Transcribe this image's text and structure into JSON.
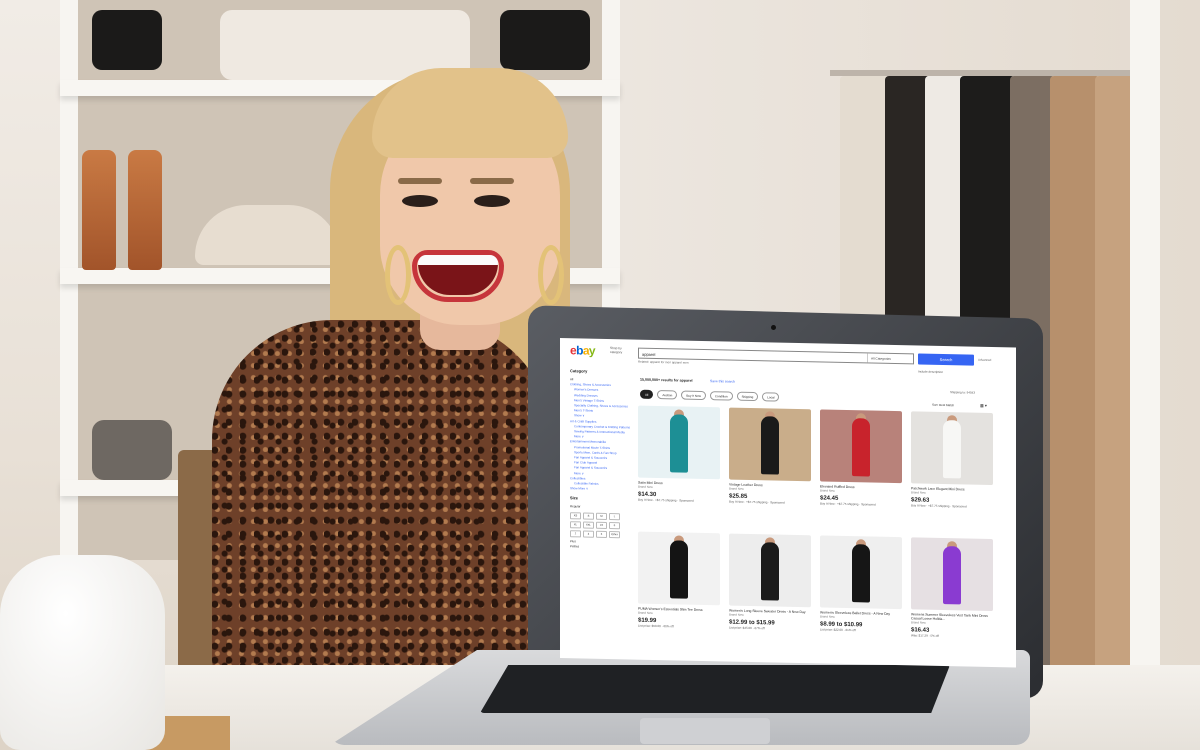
{
  "ebay": {
    "logo": {
      "e": "e",
      "b": "b",
      "a": "a",
      "y": "y"
    },
    "shop_by_category": "Shop by category",
    "search": {
      "value": "apparel",
      "category": "All Categories",
      "button": "Search",
      "advanced": "Advanced"
    },
    "related": "Related:  apparel for men   apparel men",
    "include_description": "Include description",
    "results_count": "15,000,000+ results for apparel",
    "save_search": "Save this search",
    "shipping_to": "Shipping to: 94043",
    "filters": [
      "All",
      "Auction",
      "Buy It Now",
      "Condition",
      "Shipping",
      "Local"
    ],
    "sort": "Sort: Best Match",
    "view_toggle": "▦ ▾",
    "sidebar": {
      "category_title": "Category",
      "items": [
        {
          "label": "All",
          "style": "plain"
        },
        {
          "label": "Clothing, Shoes & Accessories",
          "style": "link"
        },
        {
          "label": "Women's Dresses",
          "style": "indent"
        },
        {
          "label": "Wedding Dresses",
          "style": "indent"
        },
        {
          "label": "Men's Vintage T-Shirts",
          "style": "indent"
        },
        {
          "label": "Specialty Clothing, Shoes & Accessories",
          "style": "indent"
        },
        {
          "label": "Men's T-Shirts",
          "style": "indent"
        },
        {
          "label": "Show ∨",
          "style": "indent"
        },
        {
          "label": "Art & Craft Supplies",
          "style": "link"
        },
        {
          "label": "Contemporary Crochet & Knitting Patterns",
          "style": "indent"
        },
        {
          "label": "Sewing Patterns & Instructional Media",
          "style": "indent"
        },
        {
          "label": "More ∨",
          "style": "indent"
        },
        {
          "label": "Entertainment Memorabilia",
          "style": "link"
        },
        {
          "label": "Promotional Movie T-Shirts",
          "style": "indent"
        },
        {
          "label": "Sports Mem, Cards & Fan Shop",
          "style": "indent"
        },
        {
          "label": "Fan Apparel & Souvenirs",
          "style": "indent"
        },
        {
          "label": "Fan Club Apparel",
          "style": "indent"
        },
        {
          "label": "Fan Apparel & Souvenirs",
          "style": "indent"
        },
        {
          "label": "More ∨",
          "style": "indent"
        },
        {
          "label": "Collectibles",
          "style": "link"
        },
        {
          "label": "Collectible Fabrics",
          "style": "indent"
        },
        {
          "label": "Show More ∨",
          "style": "link"
        }
      ],
      "size_title": "Size",
      "size_type": "Regular",
      "sizes": [
        "XS",
        "S",
        "M",
        "L",
        "XL",
        "XXL",
        "2X",
        "0",
        "2",
        "4",
        "6",
        "Other"
      ],
      "plus": "Plus",
      "petites": "Petites"
    },
    "products": [
      {
        "title": "Satin Mini Dress",
        "cond": "Brand New",
        "price": "$14.30",
        "meta": "Buy It Now · +$7.75 shipping · Sponsored",
        "bg": "#e8f2f4",
        "fig": "#1d8f95"
      },
      {
        "title": "Vintage Leather Dress",
        "cond": "Brand New",
        "price": "$25.85",
        "meta": "Buy It Now · +$7.75 shipping · Sponsored",
        "bg": "#c9ad8a",
        "fig": "#1a1a1a"
      },
      {
        "title": "Elevated Ruffled Dress",
        "cond": "Brand New",
        "price": "$24.45",
        "meta": "Buy It Now · +$7.75 shipping · Sponsored",
        "bg": "#b8827a",
        "fig": "#c8232c"
      },
      {
        "title": "Patchwork Lace Elegant Mini Dress",
        "cond": "Brand New",
        "price": "$29.63",
        "meta": "Buy It Now · +$7.75 shipping · Sponsored",
        "bg": "#e4e2df",
        "fig": "#f7f7f5"
      },
      {
        "title": "PUMA Women's Essentials Slim Tee Dress",
        "cond": "Brand New",
        "price": "$19.99",
        "meta": "List price: $50.00 · 60% off",
        "bg": "#f2f2f2",
        "fig": "#141414"
      },
      {
        "title": "Women's Long Sleeve Sweater Dress - A New Day",
        "cond": "Brand New",
        "price": "$12.99 to $15.99",
        "meta": "List price: $45.00 · 67% off",
        "bg": "#ededed",
        "fig": "#1b1b1b"
      },
      {
        "title": "Women's Sleeveless Ballet Dress - A New Day",
        "cond": "Brand New",
        "price": "$8.99 to $10.99",
        "meta": "List price: $22.00 · 61% off",
        "bg": "#efefef",
        "fig": "#161616"
      },
      {
        "title": "Womens Summer Sleeveless Vest Tank Mini Dress Casual Loose Holida...",
        "cond": "Brand New",
        "price": "$16.43",
        "meta": "Was: $17.29 · 5% off",
        "bg": "#e6e0e3",
        "fig": "#8a3bd1"
      }
    ]
  }
}
